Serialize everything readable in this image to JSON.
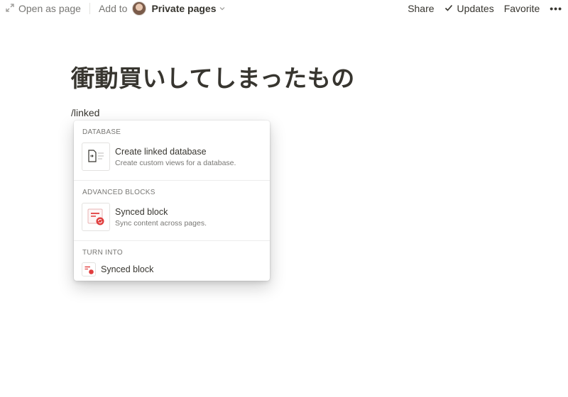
{
  "topbar": {
    "open_as_page": "Open as page",
    "add_to": "Add to",
    "workspace": "Private pages",
    "share": "Share",
    "updates": "Updates",
    "favorite": "Favorite",
    "more": "•••"
  },
  "page": {
    "title": "衝動買いしてしまったもの",
    "command_text": "/linked"
  },
  "menu": {
    "sections": [
      {
        "header": "DATABASE",
        "items": [
          {
            "title": "Create linked database",
            "description": "Create custom views for a database.",
            "icon": "linked-database-icon"
          }
        ]
      },
      {
        "header": "ADVANCED BLOCKS",
        "items": [
          {
            "title": "Synced block",
            "description": "Sync content across pages.",
            "icon": "synced-block-icon"
          }
        ]
      },
      {
        "header": "TURN INTO",
        "items": [
          {
            "title": "Synced block",
            "icon": "synced-block-small-icon"
          }
        ]
      }
    ]
  },
  "colors": {
    "text": "#37352f",
    "muted": "#787774",
    "synced_red": "#e03e3e"
  }
}
